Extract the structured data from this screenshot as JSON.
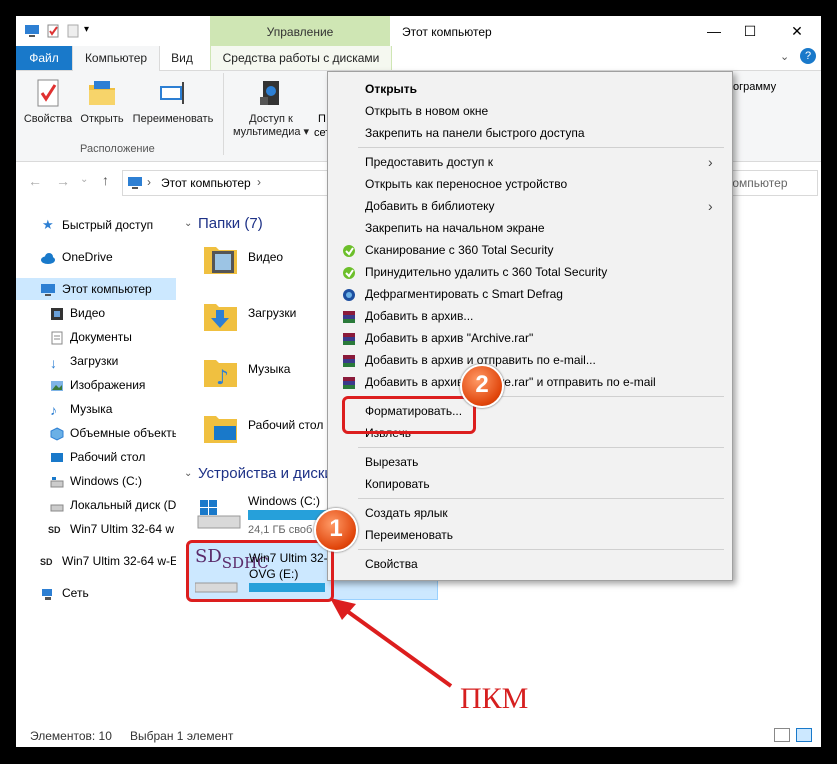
{
  "window": {
    "title": "Этот компьютер",
    "ribbon_context_group": "Управление",
    "controls": {
      "minimize": "—",
      "maximize": "☐",
      "close": "✕"
    }
  },
  "tabs": [
    "Файл",
    "Компьютер",
    "Вид",
    "Средства работы с дисками"
  ],
  "ribbon": {
    "buttons": [
      "Свойства",
      "Открыть",
      "Переименовать"
    ],
    "group_label": "Расположение",
    "media": [
      "Доступ к",
      "мультимедиа ▾"
    ],
    "cut_label": "П",
    "cut_label_2": "сет",
    "right_fragment": "ограмму"
  },
  "address": {
    "path": "Этот компьютер",
    "search_placeholder": "компьютер"
  },
  "nav": {
    "items": [
      {
        "label": "Быстрый доступ",
        "icon": "star-icon"
      },
      {
        "label": "OneDrive",
        "icon": "cloud-icon"
      },
      {
        "label": "Этот компьютер",
        "icon": "computer-icon"
      },
      {
        "label": "Видео",
        "icon": "video-icon"
      },
      {
        "label": "Документы",
        "icon": "documents-icon"
      },
      {
        "label": "Загрузки",
        "icon": "downloads-icon"
      },
      {
        "label": "Изображения",
        "icon": "images-icon"
      },
      {
        "label": "Музыка",
        "icon": "music-icon"
      },
      {
        "label": "Объемные объекты",
        "icon": "3d-icon"
      },
      {
        "label": "Рабочий стол",
        "icon": "desktop-icon"
      },
      {
        "label": "Windows (C:)",
        "icon": "drive-icon"
      },
      {
        "label": "Локальный диск (D",
        "icon": "drive-icon"
      },
      {
        "label": "Win7 Ultim 32-64 w",
        "icon": "sd-icon"
      },
      {
        "label": "Win7 Ultim 32-64 w-E",
        "icon": "sd-icon"
      },
      {
        "label": "Сеть",
        "icon": "network-icon"
      }
    ]
  },
  "main": {
    "folders_header": "Папки (7)",
    "folders": [
      "Видео",
      "Загрузки",
      "Музыка",
      "Рабочий стол"
    ],
    "devices_header": "Устройства и диски",
    "drives": [
      {
        "name": "Windows (C:)",
        "info": "24,1 ГБ своб"
      },
      {
        "name": "Win7 Ultim 32-",
        "label2": "OVG (E:)",
        "logo_text": "SDHC"
      }
    ]
  },
  "context_menu": {
    "items": [
      {
        "label": "Открыть",
        "bold": true
      },
      {
        "label": "Открыть в новом окне"
      },
      {
        "label": "Закрепить на панели быстрого доступа"
      },
      {
        "label": "Предоставить доступ к",
        "submenu": true
      },
      {
        "label": "Открыть как переносное устройство"
      },
      {
        "label": "Добавить в библиотеку",
        "submenu": true
      },
      {
        "label": "Закрепить на начальном экране"
      },
      {
        "label": "Сканирование с 360 Total Security",
        "icon": "360-icon"
      },
      {
        "label": "Принудительно удалить с  360 Total Security",
        "icon": "360-icon"
      },
      {
        "label": "Дефрагментировать с Smart Defrag",
        "icon": "defrag-icon"
      },
      {
        "label": "Добавить в архив...",
        "icon": "rar-icon"
      },
      {
        "label": "Добавить в архив \"Archive.rar\"",
        "icon": "rar-icon"
      },
      {
        "label": "Добавить в архив и отправить по e-mail...",
        "icon": "rar-icon"
      },
      {
        "label": "Добавить в архив \"Archive.rar\" и отправить по e-mail",
        "icon": "rar-icon"
      },
      {
        "label": "Форматировать..."
      },
      {
        "label": "Извлечь"
      },
      {
        "label": "Вырезать"
      },
      {
        "label": "Копировать"
      },
      {
        "label": "Создать ярлык"
      },
      {
        "label": "Переименовать"
      },
      {
        "label": "Свойства"
      }
    ]
  },
  "status": {
    "count": "Элементов: 10",
    "selected": "Выбран 1 элемент"
  },
  "annotations": {
    "badge1": "1",
    "badge2": "2",
    "caption": "ПКМ"
  },
  "colors": {
    "accent": "#1979ca",
    "highlight": "#dc1e1e",
    "selection": "#cce8ff"
  }
}
